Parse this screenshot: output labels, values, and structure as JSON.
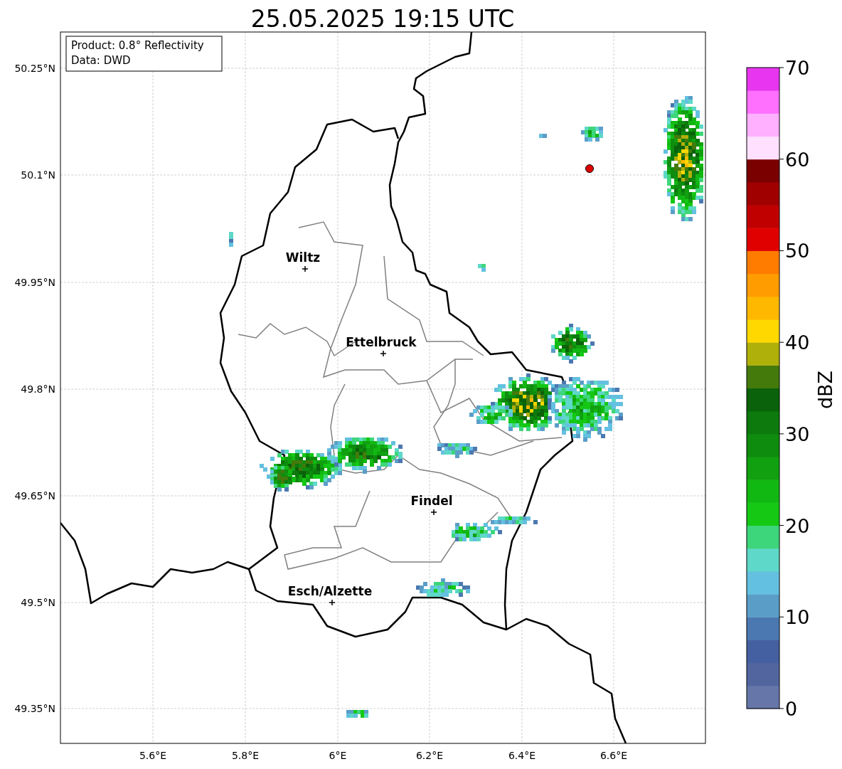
{
  "title": "25.05.2025 19:15 UTC",
  "info_box": [
    "Product: 0.8° Reflectivity",
    "Data: DWD"
  ],
  "lat_ticks": [
    "50.25°N",
    "50.1°N",
    "49.95°N",
    "49.8°N",
    "49.65°N",
    "49.5°N",
    "49.35°N"
  ],
  "lon_ticks": [
    "5.6°E",
    "5.8°E",
    "6°E",
    "6.2°E",
    "6.4°E",
    "6.6°E"
  ],
  "cities": [
    {
      "name": "Wiltz"
    },
    {
      "name": "Ettelbruck"
    },
    {
      "name": "Findel"
    },
    {
      "name": "Esch/Alzette"
    }
  ],
  "colorbar": {
    "label": "dBZ",
    "ticks": [
      "70",
      "60",
      "50",
      "40",
      "30",
      "20",
      "10",
      "0"
    ],
    "bins": [
      {
        "color": "#6676a8"
      },
      {
        "color": "#52659e"
      },
      {
        "color": "#4560a0"
      },
      {
        "color": "#4b78b0"
      },
      {
        "color": "#5a9ec8"
      },
      {
        "color": "#64c0e0"
      },
      {
        "color": "#5ed8c8"
      },
      {
        "color": "#3ed67a"
      },
      {
        "color": "#14c814"
      },
      {
        "color": "#12b812"
      },
      {
        "color": "#10a010"
      },
      {
        "color": "#0e8c0e"
      },
      {
        "color": "#0c7a0c"
      },
      {
        "color": "#0a620a"
      },
      {
        "color": "#447a0c"
      },
      {
        "color": "#b0b00a"
      },
      {
        "color": "#ffd800"
      },
      {
        "color": "#ffb800"
      },
      {
        "color": "#ff9c00"
      },
      {
        "color": "#ff7c00"
      },
      {
        "color": "#e00000"
      },
      {
        "color": "#c00000"
      },
      {
        "color": "#a00000"
      },
      {
        "color": "#7a0000"
      },
      {
        "color": "#ffe0ff"
      },
      {
        "color": "#ffb0ff"
      },
      {
        "color": "#ff70ff"
      },
      {
        "color": "#e836f0"
      }
    ]
  }
}
